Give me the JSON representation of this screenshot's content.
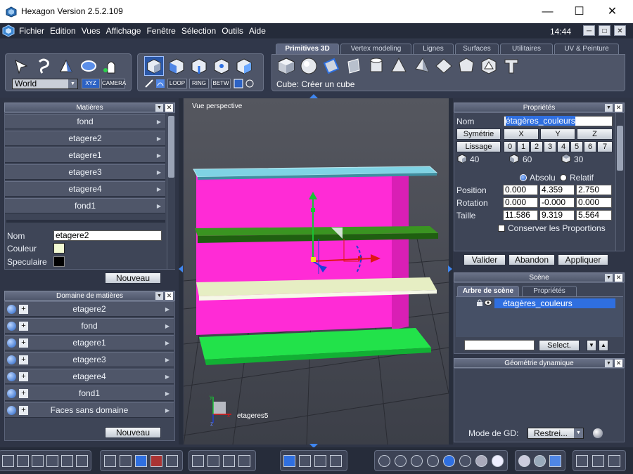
{
  "window": {
    "title": "Hexagon Version 2.5.2.109",
    "minimize": "—",
    "maximize": "☐",
    "close": "✕"
  },
  "menu": {
    "items": [
      "Fichier",
      "Edition",
      "Vues",
      "Affichage",
      "Fenêtre",
      "Sélection",
      "Outils",
      "Aide"
    ],
    "clock": "14:44"
  },
  "toolbar": {
    "coord_select": "World",
    "xyz": "XYZ",
    "camera": "CAMERA",
    "loop": "LOOP",
    "ring": "RING",
    "betw": "BETW",
    "tabs": [
      "Primitives 3D",
      "Vertex modeling",
      "Lignes",
      "Surfaces",
      "Utilitaires",
      "UV & Peinture"
    ],
    "active_tab": "Primitives 3D",
    "status": "Cube: Créer un cube"
  },
  "materials": {
    "title": "Matières",
    "items": [
      "fond",
      "etagere2",
      "etagere1",
      "etagere3",
      "etagere4",
      "fond1"
    ],
    "name_label": "Nom",
    "name_value": "etagere2",
    "color_label": "Couleur",
    "spec_label": "Speculaire",
    "new_button": "Nouveau",
    "color_value": "#f2fad2",
    "spec_value": "#000000"
  },
  "domains": {
    "title": "Domaine de matières",
    "items": [
      "etagere2",
      "fond",
      "etagere1",
      "etagere3",
      "etagere4",
      "fond1",
      "Faces sans domaine"
    ],
    "new_button": "Nouveau"
  },
  "viewport": {
    "label": "Vue perspective",
    "object_label": "etageres5"
  },
  "properties": {
    "title": "Propriétés",
    "name_label": "Nom",
    "name_value": "étagères_couleurs",
    "symmetry_label": "Symétrie",
    "axes": [
      "X",
      "Y",
      "Z"
    ],
    "smoothing_label": "Lissage",
    "smoothing_levels": [
      "0",
      "1",
      "2",
      "3",
      "4",
      "5",
      "6",
      "7"
    ],
    "counts": [
      "40",
      "60",
      "30"
    ],
    "absolute_label": "Absolu",
    "relative_label": "Relatif",
    "position_label": "Position",
    "position": [
      "0.000",
      "4.359",
      "2.750"
    ],
    "rotation_label": "Rotation",
    "rotation": [
      "0.000",
      "-0.000",
      "0.000"
    ],
    "size_label": "Taille",
    "size": [
      "11.586",
      "9.319",
      "5.564"
    ],
    "keep_proportions": "Conserver les Proportions",
    "validate": "Valider",
    "cancel": "Abandon",
    "apply": "Appliquer"
  },
  "scene": {
    "title": "Scène",
    "tabs": [
      "Arbre de scène",
      "Propriétés"
    ],
    "node": "étagères_couleurs",
    "select_button": "Select."
  },
  "dyn_geo": {
    "title": "Géométrie dynamique",
    "mode_label": "Mode de GD:",
    "mode_value": "Restrei..."
  },
  "colors": {
    "magenta": "#ff2bd6",
    "shelf_dark": "#2e7d17",
    "shelf_light": "#e8f0c8",
    "shelf_green": "#22e24a",
    "top": "#6fc6d8",
    "selection": "#2f6fe0"
  }
}
